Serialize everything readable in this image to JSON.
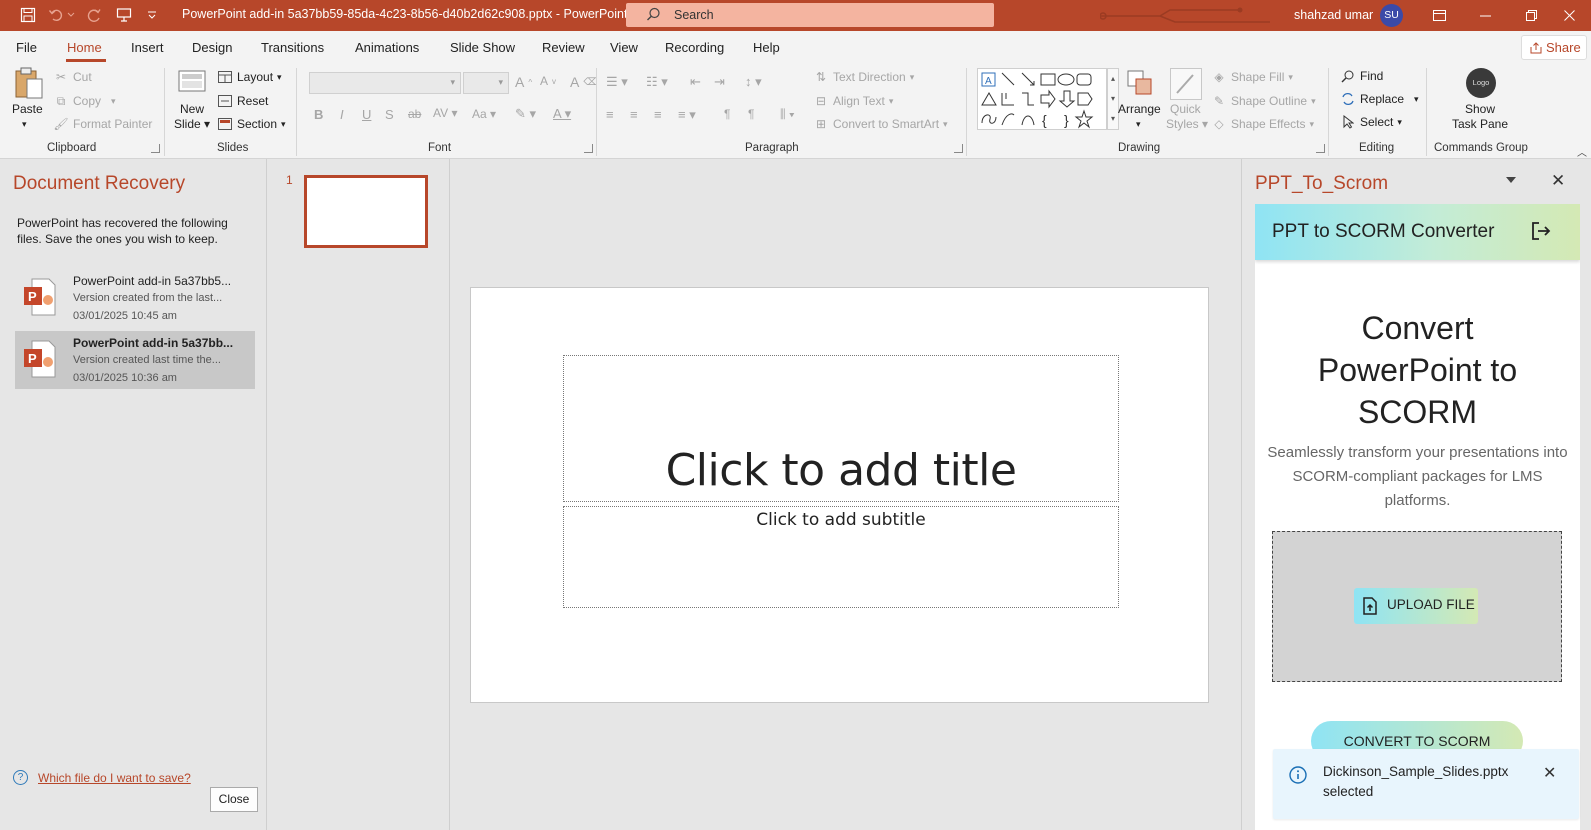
{
  "titlebar": {
    "document_title": "PowerPoint add-in 5a37bb59-85da-4c23-8b56-d40b2d62c908.pptx  -  PowerPoint",
    "search_placeholder": "Search",
    "username": "shahzad umar",
    "avatar_initials": "SU"
  },
  "tabs": [
    "File",
    "Home",
    "Insert",
    "Design",
    "Transitions",
    "Animations",
    "Slide Show",
    "Review",
    "View",
    "Recording",
    "Help"
  ],
  "active_tab": "Home",
  "share_label": "Share",
  "ribbon": {
    "clipboard": {
      "label": "Clipboard",
      "paste": "Paste",
      "cut": "Cut",
      "copy": "Copy",
      "format_painter": "Format Painter"
    },
    "slides": {
      "label": "Slides",
      "new_slide_1": "New",
      "new_slide_2": "Slide",
      "layout": "Layout",
      "reset": "Reset",
      "section": "Section"
    },
    "font": {
      "label": "Font"
    },
    "paragraph": {
      "label": "Paragraph",
      "text_direction": "Text Direction",
      "align_text": "Align Text",
      "convert_smartart": "Convert to SmartArt"
    },
    "drawing": {
      "label": "Drawing",
      "arrange": "Arrange",
      "quick_styles_1": "Quick",
      "quick_styles_2": "Styles",
      "shape_fill": "Shape Fill",
      "shape_outline": "Shape Outline",
      "shape_effects": "Shape Effects"
    },
    "editing": {
      "label": "Editing",
      "find": "Find",
      "replace": "Replace",
      "select": "Select"
    },
    "commands": {
      "label": "Commands Group",
      "logo": "Logo",
      "show_1": "Show",
      "show_2": "Task Pane"
    }
  },
  "recovery": {
    "title": "Document Recovery",
    "description": "PowerPoint has recovered the following files.  Save the ones you wish to keep.",
    "items": [
      {
        "name": "PowerPoint add-in 5a37bb5...",
        "version": "Version created from the last...",
        "date": "03/01/2025 10:45 am"
      },
      {
        "name": "PowerPoint add-in 5a37bb...",
        "version": "Version created last time the...",
        "date": "03/01/2025 10:36 am"
      }
    ],
    "help_link": "Which file do I want to save?",
    "close_label": "Close"
  },
  "thumbnails": {
    "slide_number": "1"
  },
  "slide": {
    "title_placeholder": "Click to add title",
    "subtitle_placeholder": "Click to add subtitle"
  },
  "taskpane": {
    "title": "PPT_To_Scrom",
    "header": "PPT to SCORM Converter",
    "hero_line1": "Convert",
    "hero_line2": "PowerPoint to",
    "hero_line3": "SCORM",
    "subtitle": "Seamlessly transform your presentations into SCORM-compliant packages for LMS platforms.",
    "upload_label": "UPLOAD FILE",
    "convert_label": "CONVERT TO SCORM",
    "toast": "Dickinson_Sample_Slides.pptx selected"
  },
  "colors": {
    "accent": "#b7472a",
    "toast_bg": "#e8f5fd",
    "gradient_start": "#8fe4f4",
    "gradient_end": "#d4e9b4"
  }
}
